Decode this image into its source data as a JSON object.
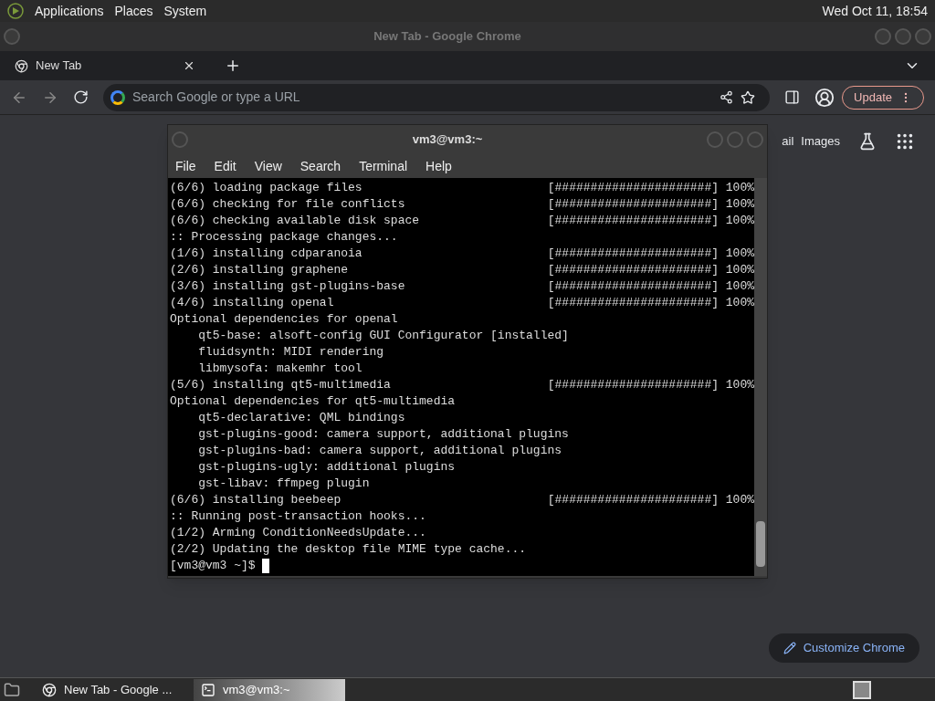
{
  "top_panel": {
    "menus": [
      "Applications",
      "Places",
      "System"
    ],
    "clock": "Wed Oct 11, 18:54"
  },
  "browser": {
    "title": "New Tab - Google Chrome",
    "tabs": [
      {
        "label": "New Tab",
        "selected": true
      }
    ],
    "omnibox": {
      "placeholder": "Search Google or type a URL"
    },
    "update_button": "Update",
    "page": {
      "links": [
        "ail",
        "Images"
      ],
      "customize_button": "Customize Chrome"
    }
  },
  "terminal": {
    "title": "vm3@vm3:~",
    "menus": [
      "File",
      "Edit",
      "View",
      "Search",
      "Terminal",
      "Help"
    ],
    "lines": [
      {
        "text": "(6/6) loading package files",
        "bar": "[######################] 100%"
      },
      {
        "text": "(6/6) checking for file conflicts",
        "bar": "[######################] 100%"
      },
      {
        "text": "(6/6) checking available disk space",
        "bar": "[######################] 100%"
      },
      {
        "text": ":: Processing package changes..."
      },
      {
        "text": "(1/6) installing cdparanoia",
        "bar": "[######################] 100%"
      },
      {
        "text": "(2/6) installing graphene",
        "bar": "[######################] 100%"
      },
      {
        "text": "(3/6) installing gst-plugins-base",
        "bar": "[######################] 100%"
      },
      {
        "text": "(4/6) installing openal",
        "bar": "[######################] 100%"
      },
      {
        "text": "Optional dependencies for openal"
      },
      {
        "text": "    qt5-base: alsoft-config GUI Configurator [installed]"
      },
      {
        "text": "    fluidsynth: MIDI rendering"
      },
      {
        "text": "    libmysofa: makemhr tool"
      },
      {
        "text": "(5/6) installing qt5-multimedia",
        "bar": "[######################] 100%"
      },
      {
        "text": "Optional dependencies for qt5-multimedia"
      },
      {
        "text": "    qt5-declarative: QML bindings"
      },
      {
        "text": "    gst-plugins-good: camera support, additional plugins"
      },
      {
        "text": "    gst-plugins-bad: camera support, additional plugins"
      },
      {
        "text": "    gst-plugins-ugly: additional plugins"
      },
      {
        "text": "    gst-libav: ffmpeg plugin"
      },
      {
        "text": "(6/6) installing beebeep",
        "bar": "[######################] 100%"
      },
      {
        "text": ":: Running post-transaction hooks..."
      },
      {
        "text": "(1/2) Arming ConditionNeedsUpdate..."
      },
      {
        "text": "(2/2) Updating the desktop file MIME type cache..."
      }
    ],
    "prompt": "[vm3@vm3 ~]$"
  },
  "taskbar": {
    "items": [
      {
        "label": "New Tab - Google ...",
        "kind": "chrome",
        "selected": false
      },
      {
        "label": "vm3@vm3:~",
        "kind": "terminal",
        "selected": true
      }
    ]
  }
}
